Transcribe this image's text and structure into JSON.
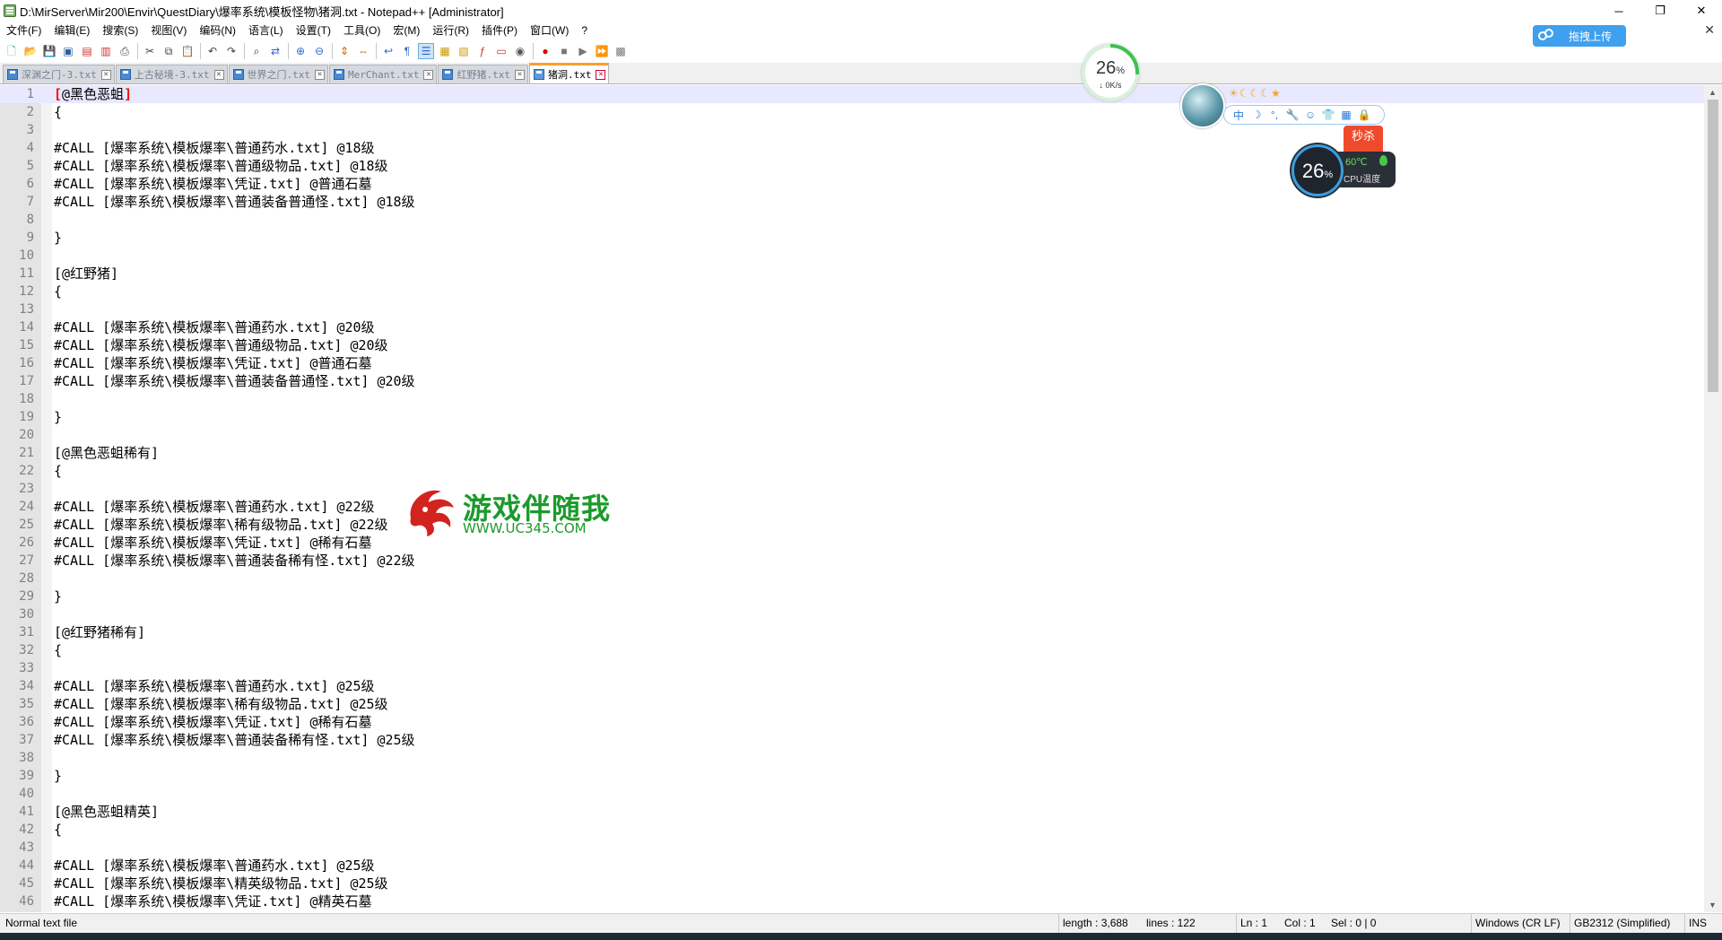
{
  "window": {
    "title": "D:\\MirServer\\Mir200\\Envir\\QuestDiary\\爆率系统\\模板怪物\\猪洞.txt - Notepad++ [Administrator]",
    "minimize": "─",
    "restore": "❐",
    "close": "✕"
  },
  "menu": {
    "items": [
      "文件(F)",
      "编辑(E)",
      "搜索(S)",
      "视图(V)",
      "编码(N)",
      "语言(L)",
      "设置(T)",
      "工具(O)",
      "宏(M)",
      "运行(R)",
      "插件(P)",
      "窗口(W)",
      "?"
    ],
    "close_doc": "✕"
  },
  "toolbar": {
    "buttons": [
      {
        "icon": "new-file-icon",
        "glyph": "🗋",
        "color": "#3a7"
      },
      {
        "icon": "open-file-icon",
        "glyph": "📂",
        "color": "#d9a21b"
      },
      {
        "icon": "save-icon",
        "glyph": "💾",
        "color": "#2b5f9c"
      },
      {
        "icon": "save-all-icon",
        "glyph": "▣",
        "color": "#2b5f9c"
      },
      {
        "icon": "close-icon",
        "glyph": "▤",
        "color": "#c33"
      },
      {
        "icon": "close-all-icon",
        "glyph": "▥",
        "color": "#c33"
      },
      {
        "icon": "print-icon",
        "glyph": "⎙",
        "color": "#444"
      },
      {
        "sep": true
      },
      {
        "icon": "cut-icon",
        "glyph": "✂",
        "color": "#444"
      },
      {
        "icon": "copy-icon",
        "glyph": "⧉",
        "color": "#444"
      },
      {
        "icon": "paste-icon",
        "glyph": "📋",
        "color": "#8a6"
      },
      {
        "sep": true
      },
      {
        "icon": "undo-icon",
        "glyph": "↶",
        "color": "#444"
      },
      {
        "icon": "redo-icon",
        "glyph": "↷",
        "color": "#444"
      },
      {
        "sep": true
      },
      {
        "icon": "find-icon",
        "glyph": "⌕",
        "color": "#333"
      },
      {
        "icon": "replace-icon",
        "glyph": "⇄",
        "color": "#36c"
      },
      {
        "sep": true
      },
      {
        "icon": "zoom-in-icon",
        "glyph": "⊕",
        "color": "#36c"
      },
      {
        "icon": "zoom-out-icon",
        "glyph": "⊖",
        "color": "#36c"
      },
      {
        "sep": true
      },
      {
        "icon": "sync-vertical-icon",
        "glyph": "⇕",
        "color": "#c60"
      },
      {
        "icon": "sync-horizontal-icon",
        "glyph": "⇔",
        "color": "#c60"
      },
      {
        "sep": true
      },
      {
        "icon": "word-wrap-icon",
        "glyph": "↩",
        "color": "#36c"
      },
      {
        "icon": "show-all-chars-icon",
        "glyph": "¶",
        "color": "#36c"
      },
      {
        "icon": "indent-guide-icon",
        "glyph": "☰",
        "color": "#36c",
        "active": true
      },
      {
        "icon": "udl-icon",
        "glyph": "▦",
        "color": "#c90"
      },
      {
        "icon": "doc-map-icon",
        "glyph": "▧",
        "color": "#c90"
      },
      {
        "icon": "function-list-icon",
        "glyph": "ƒ",
        "color": "#c33"
      },
      {
        "icon": "folder-workspace-icon",
        "glyph": "▭",
        "color": "#c33"
      },
      {
        "icon": "monitoring-icon",
        "glyph": "◉",
        "color": "#555"
      },
      {
        "sep": true
      },
      {
        "icon": "record-macro-icon",
        "glyph": "●",
        "color": "#d00"
      },
      {
        "icon": "stop-macro-icon",
        "glyph": "■",
        "color": "#777"
      },
      {
        "icon": "play-macro-icon",
        "glyph": "▶",
        "color": "#777"
      },
      {
        "icon": "run-macro-multiple-icon",
        "glyph": "⏩",
        "color": "#36c"
      },
      {
        "icon": "save-macro-icon",
        "glyph": "▩",
        "color": "#777"
      }
    ]
  },
  "cloud_upload": {
    "label": "拖拽上传"
  },
  "tabs": [
    {
      "label": "深渊之门-3.txt",
      "active": false
    },
    {
      "label": "上古秘境-3.txt",
      "active": false
    },
    {
      "label": "世界之门.txt",
      "active": false
    },
    {
      "label": "MerChant.txt",
      "active": false
    },
    {
      "label": "红野猪.txt",
      "active": false
    },
    {
      "label": "猪洞.txt",
      "active": true
    }
  ],
  "editor": {
    "lines": [
      {
        "n": "1",
        "text": "[@黑色恶蛆]",
        "current": true
      },
      {
        "n": "2",
        "text": "{"
      },
      {
        "n": "3",
        "text": ""
      },
      {
        "n": "4",
        "text": "#CALL [爆率系统\\模板爆率\\普通药水.txt] @18级"
      },
      {
        "n": "5",
        "text": "#CALL [爆率系统\\模板爆率\\普通级物品.txt] @18级"
      },
      {
        "n": "6",
        "text": "#CALL [爆率系统\\模板爆率\\凭证.txt] @普通石墓"
      },
      {
        "n": "7",
        "text": "#CALL [爆率系统\\模板爆率\\普通装备普通怪.txt] @18级"
      },
      {
        "n": "8",
        "text": ""
      },
      {
        "n": "9",
        "text": "}"
      },
      {
        "n": "10",
        "text": ""
      },
      {
        "n": "11",
        "text": "[@红野猪]"
      },
      {
        "n": "12",
        "text": "{"
      },
      {
        "n": "13",
        "text": ""
      },
      {
        "n": "14",
        "text": "#CALL [爆率系统\\模板爆率\\普通药水.txt] @20级"
      },
      {
        "n": "15",
        "text": "#CALL [爆率系统\\模板爆率\\普通级物品.txt] @20级"
      },
      {
        "n": "16",
        "text": "#CALL [爆率系统\\模板爆率\\凭证.txt] @普通石墓"
      },
      {
        "n": "17",
        "text": "#CALL [爆率系统\\模板爆率\\普通装备普通怪.txt] @20级"
      },
      {
        "n": "18",
        "text": ""
      },
      {
        "n": "19",
        "text": "}"
      },
      {
        "n": "20",
        "text": ""
      },
      {
        "n": "21",
        "text": "[@黑色恶蛆稀有]"
      },
      {
        "n": "22",
        "text": "{"
      },
      {
        "n": "23",
        "text": ""
      },
      {
        "n": "24",
        "text": "#CALL [爆率系统\\模板爆率\\普通药水.txt] @22级"
      },
      {
        "n": "25",
        "text": "#CALL [爆率系统\\模板爆率\\稀有级物品.txt] @22级"
      },
      {
        "n": "26",
        "text": "#CALL [爆率系统\\模板爆率\\凭证.txt] @稀有石墓"
      },
      {
        "n": "27",
        "text": "#CALL [爆率系统\\模板爆率\\普通装备稀有怪.txt] @22级"
      },
      {
        "n": "28",
        "text": ""
      },
      {
        "n": "29",
        "text": "}"
      },
      {
        "n": "30",
        "text": ""
      },
      {
        "n": "31",
        "text": "[@红野猪稀有]"
      },
      {
        "n": "32",
        "text": "{"
      },
      {
        "n": "33",
        "text": ""
      },
      {
        "n": "34",
        "text": "#CALL [爆率系统\\模板爆率\\普通药水.txt] @25级"
      },
      {
        "n": "35",
        "text": "#CALL [爆率系统\\模板爆率\\稀有级物品.txt] @25级"
      },
      {
        "n": "36",
        "text": "#CALL [爆率系统\\模板爆率\\凭证.txt] @稀有石墓"
      },
      {
        "n": "37",
        "text": "#CALL [爆率系统\\模板爆率\\普通装备稀有怪.txt] @25级"
      },
      {
        "n": "38",
        "text": ""
      },
      {
        "n": "39",
        "text": "}"
      },
      {
        "n": "40",
        "text": ""
      },
      {
        "n": "41",
        "text": "[@黑色恶蛆精英]"
      },
      {
        "n": "42",
        "text": "{"
      },
      {
        "n": "43",
        "text": ""
      },
      {
        "n": "44",
        "text": "#CALL [爆率系统\\模板爆率\\普通药水.txt] @25级"
      },
      {
        "n": "45",
        "text": "#CALL [爆率系统\\模板爆率\\精英级物品.txt] @25级"
      },
      {
        "n": "46",
        "text": "#CALL [爆率系统\\模板爆率\\凭证.txt] @精英石墓"
      }
    ]
  },
  "statusbar": {
    "file_type": "Normal text file",
    "length": "length : 3,688",
    "lines": "lines : 122",
    "ln": "Ln : 1",
    "col": "Col : 1",
    "sel": "Sel : 0 | 0",
    "eol": "Windows (CR LF)",
    "encoding": "GB2312 (Simplified)",
    "mode": "INS"
  },
  "net_widget": {
    "percent": "26",
    "unit": "%",
    "speed": "↓ 0K/s",
    "fill_fraction": 0.26,
    "ring_color": "#3cc152"
  },
  "ime_bar": {
    "stars": "☀☾☾☾★",
    "tools": [
      "中",
      "☽",
      "°,",
      "🔧",
      "☺",
      "👕",
      "▦",
      "🔒"
    ]
  },
  "seckill": {
    "label": "秒杀"
  },
  "cpu_widget": {
    "percent": "26",
    "unit": "%",
    "temp": "60℃",
    "label": "CPU温度"
  },
  "watermark": {
    "title": "游戏伴随我",
    "url": "WWW.UC345.COM"
  }
}
